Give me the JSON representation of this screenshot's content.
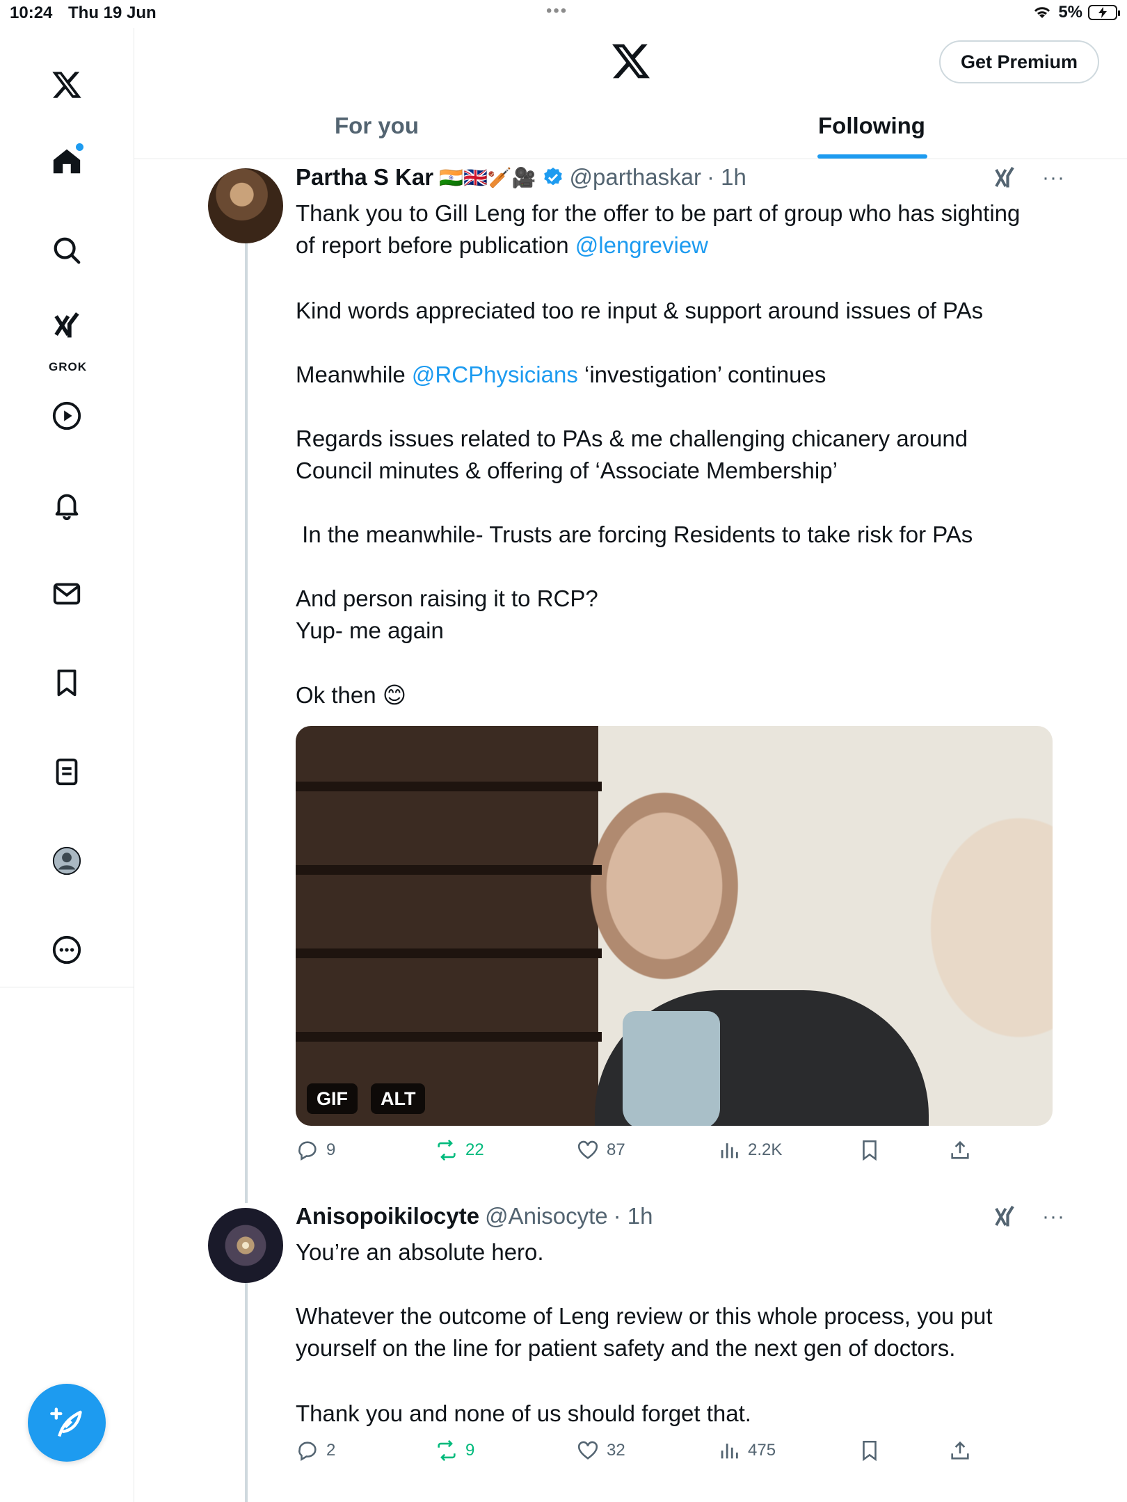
{
  "status_bar": {
    "time": "10:24",
    "date": "Thu 19 Jun",
    "battery": "5%"
  },
  "sidebar": {
    "grok_label": "GROK"
  },
  "header": {
    "premium_label": "Get Premium"
  },
  "tabs": [
    {
      "label": "For you",
      "active": false
    },
    {
      "label": "Following",
      "active": true
    }
  ],
  "posts": [
    {
      "name": "Partha S Kar",
      "name_emojis": "🇮🇳🇬🇧🏏🎥",
      "handle": "@parthaskar",
      "time": "· 1h",
      "verified": true,
      "text_1": "Thank you to Gill Leng for the offer to be part of group who has sighting\nof report before publication ",
      "mention_1": "@lengreview",
      "text_2": "Kind words appreciated too re input & support around issues of PAs",
      "text_3a": "Meanwhile ",
      "mention_2": "@RCPhysicians",
      "text_3b": " ‘investigation’ continues",
      "text_4": "Regards issues related to PAs & me challenging chicanery around\nCouncil minutes & offering of ‘Associate Membership’",
      "text_5": " In the meanwhile- Trusts are forcing Residents to take risk for PAs",
      "text_6": "And person raising it to RCP?\nYup- me again",
      "text_7": "Ok then 😊",
      "media": {
        "gif_badge": "GIF",
        "alt_badge": "ALT"
      },
      "stats": {
        "replies": "9",
        "reposts": "22",
        "likes": "87",
        "views": "2.2K"
      }
    },
    {
      "name": "Anisopoikilocyte",
      "handle": "@Anisocyte",
      "time": "· 1h",
      "text_1": "You’re an absolute hero.",
      "text_2": "Whatever the outcome of Leng review or this whole process, you put\nyourself on the line for patient safety and the next gen of doctors.",
      "text_3": "Thank you and none of us should forget that.",
      "stats": {
        "replies": "2",
        "reposts": "9",
        "likes": "32",
        "views": "475"
      }
    }
  ],
  "colors": {
    "accent": "#1d9bf0",
    "repost": "#00ba7c",
    "muted": "#536471",
    "text": "#0f1419"
  }
}
